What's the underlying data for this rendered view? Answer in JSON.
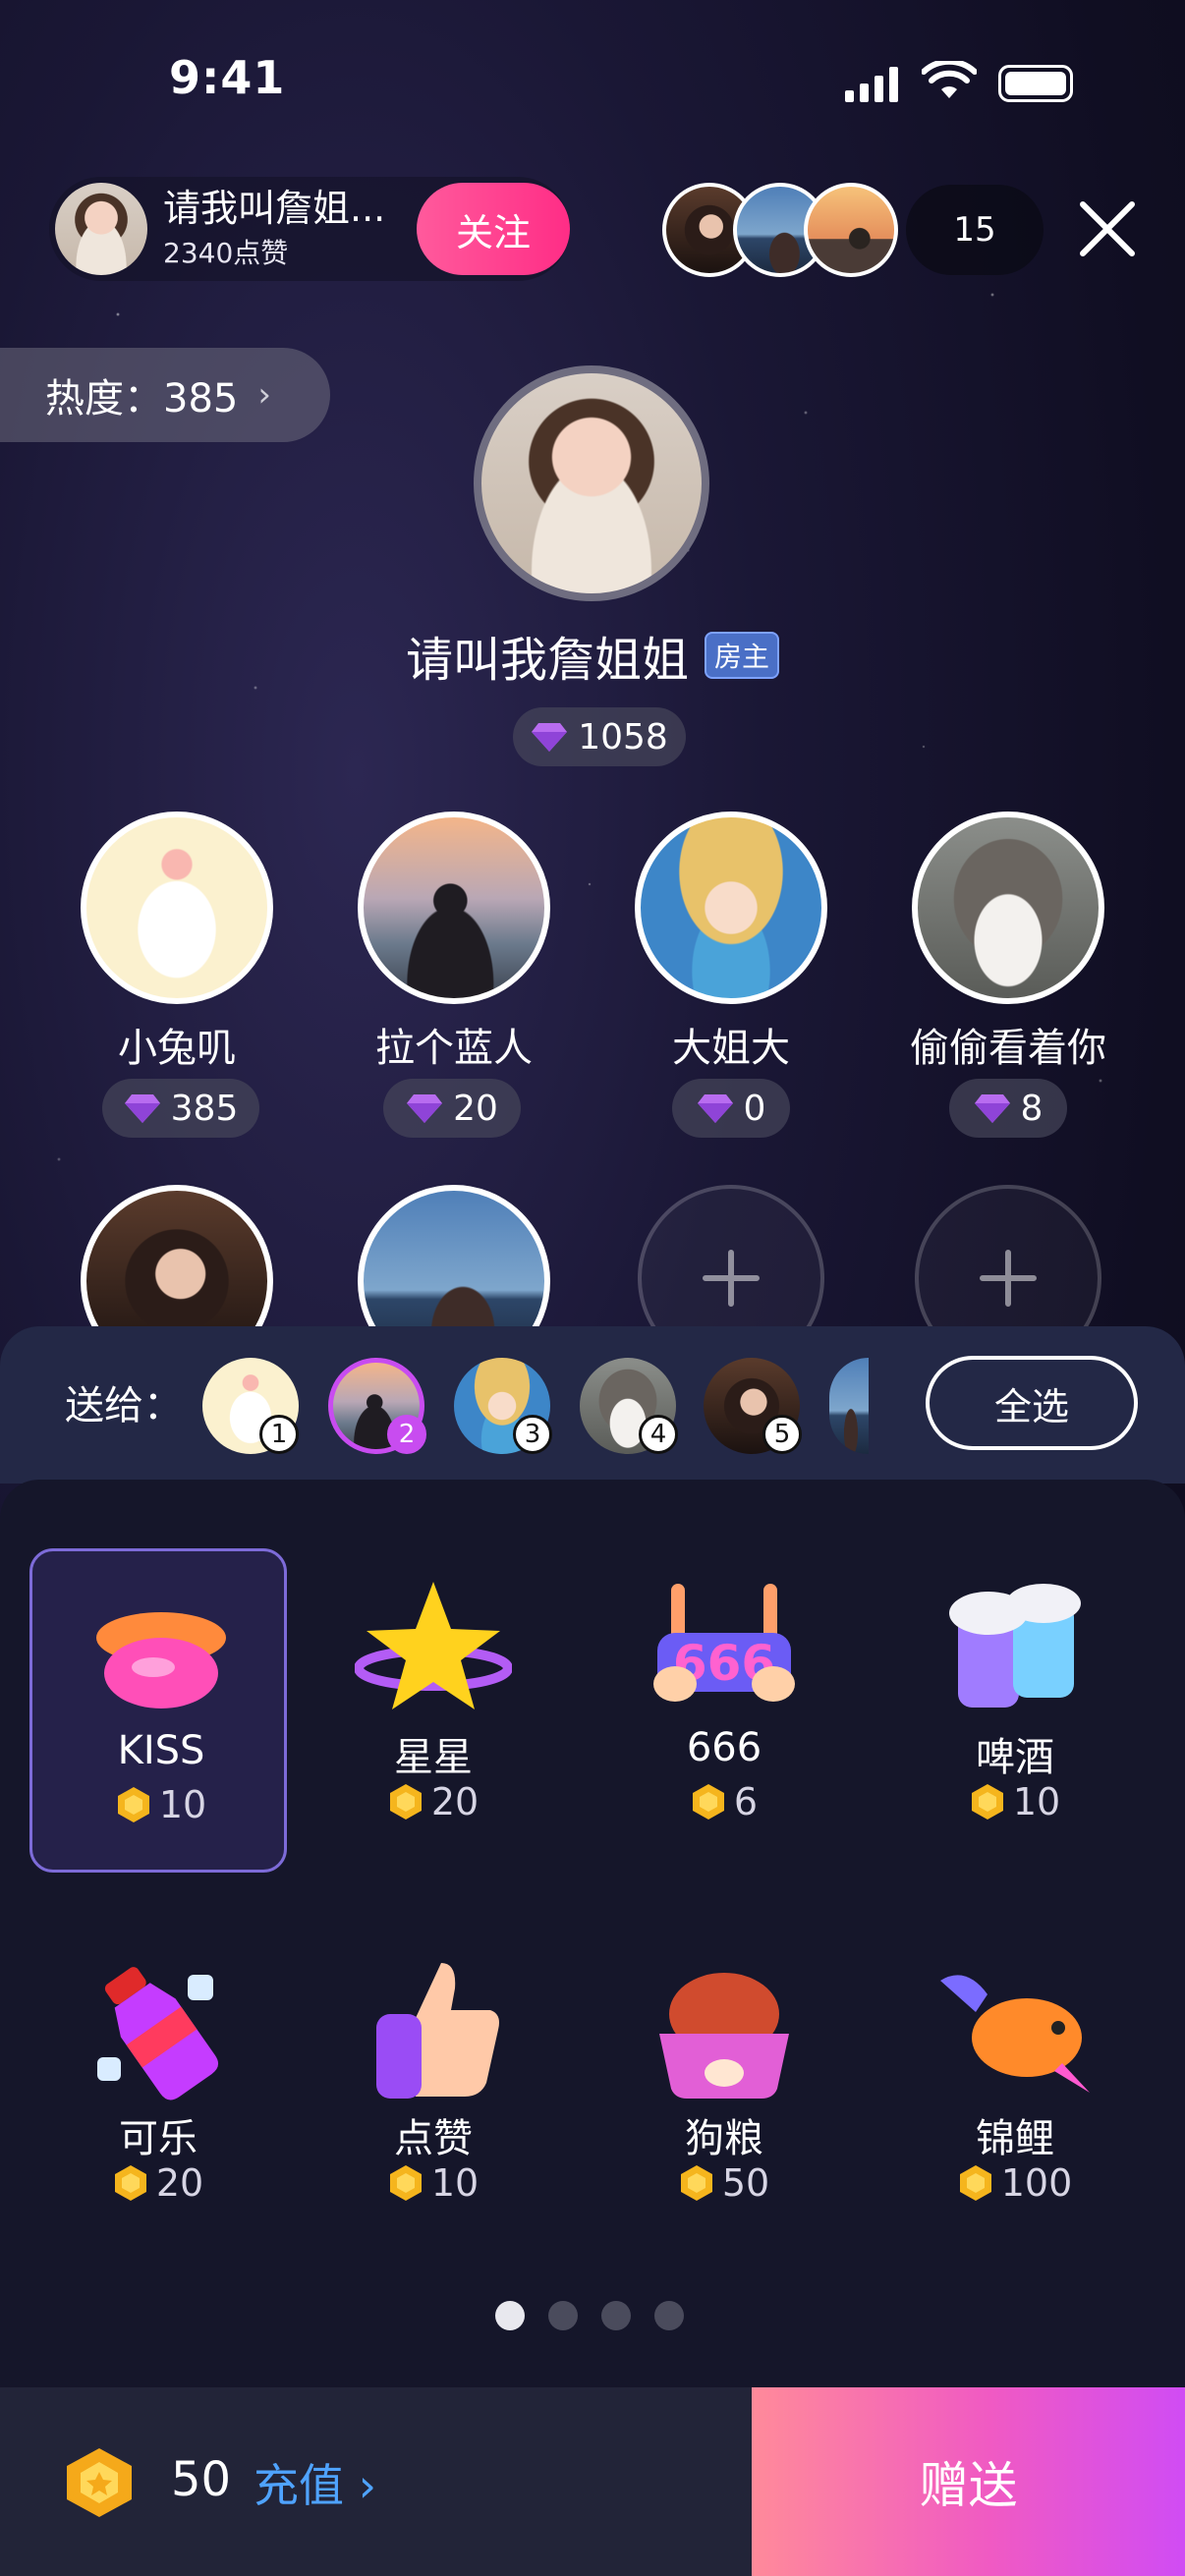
{
  "status_bar": {
    "time": "9:41"
  },
  "host": {
    "name_pill": "请我叫詹姐...",
    "likes": "2340点赞",
    "follow_label": "关注",
    "seat_name": "请叫我詹姐姐",
    "role_tag": "房主",
    "gems": "1058"
  },
  "viewers": {
    "count": "15"
  },
  "heat": {
    "label": "热度：385"
  },
  "seats": [
    {
      "name": "小兔叽",
      "gems": "385"
    },
    {
      "name": "拉个蓝人",
      "gems": "20"
    },
    {
      "name": "大姐大",
      "gems": "0"
    },
    {
      "name": "偷偷看着你",
      "gems": "8"
    }
  ],
  "send_to": {
    "label": "送给：",
    "select_all": "全选",
    "recipients": [
      "1",
      "2",
      "3",
      "4",
      "5"
    ],
    "selected": "2"
  },
  "gifts": [
    {
      "name": "KISS",
      "price": "10",
      "icon": "lips-icon",
      "selected": true
    },
    {
      "name": "星星",
      "price": "20",
      "icon": "star-icon"
    },
    {
      "name": "666",
      "price": "6",
      "icon": "666-sign-icon"
    },
    {
      "name": "啤酒",
      "price": "10",
      "icon": "beer-icon"
    },
    {
      "name": "可乐",
      "price": "20",
      "icon": "cola-icon"
    },
    {
      "name": "点赞",
      "price": "10",
      "icon": "thumbs-up-icon"
    },
    {
      "name": "狗粮",
      "price": "50",
      "icon": "dog-food-icon"
    },
    {
      "name": "锦鲤",
      "price": "100",
      "icon": "koi-fish-icon"
    }
  ],
  "pagination": {
    "pages": 4,
    "current": 1
  },
  "wallet": {
    "balance": "50",
    "recharge_label": "充值",
    "send_label": "赠送"
  },
  "colors": {
    "follow": "#ff2d86",
    "recharge": "#4fa3ff",
    "send_start": "#ff8a9a",
    "send_end": "#d04cf4",
    "selected_border": "#7d6bd8"
  }
}
